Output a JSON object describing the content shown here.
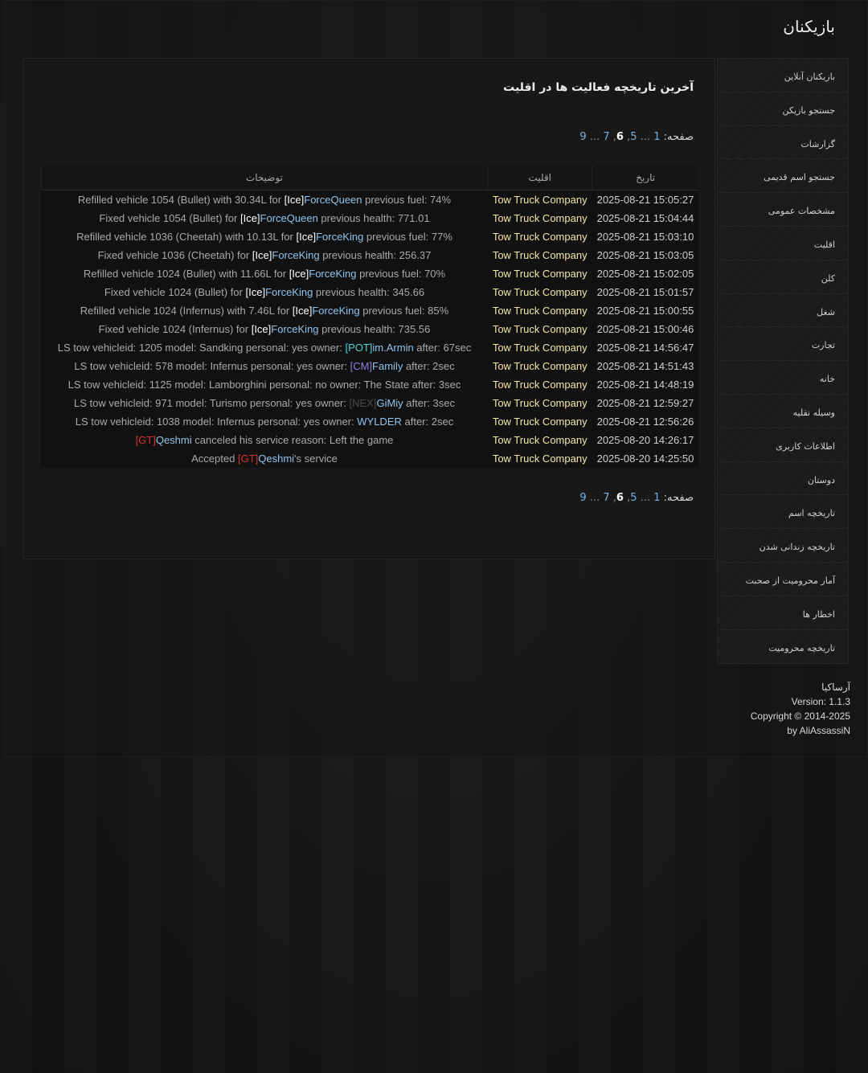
{
  "page_title": "بازیکنان",
  "sidebar": {
    "items": [
      {
        "label": "بازیکنان آنلاین"
      },
      {
        "label": "جستجو بازیکن"
      },
      {
        "label": "گزارشات"
      },
      {
        "label": "جستجو اسم قدیمی"
      },
      {
        "label": "مشخصات عمومی"
      },
      {
        "label": "اقلیت"
      },
      {
        "label": "کلن"
      },
      {
        "label": "شغل"
      },
      {
        "label": "تجارت"
      },
      {
        "label": "خانه"
      },
      {
        "label": "وسیله نقلیه"
      },
      {
        "label": "اطلاعات کاربری"
      },
      {
        "label": "دوستان"
      },
      {
        "label": "تاریخچه اسم"
      },
      {
        "label": "تاریخچه زندانی شدن"
      },
      {
        "label": "آمار محرومیت از صحبت"
      },
      {
        "label": "اخطار ها"
      },
      {
        "label": "تاریخچه محرومیت"
      }
    ]
  },
  "main": {
    "heading": "آخرین تاریخچه فعالیت ها در اقلیت",
    "pagination": {
      "label": "صفحه:",
      "first": "1",
      "ellipsis": "...",
      "p5": "5",
      "p6": "6",
      "p7": "7",
      "last": "9"
    },
    "table": {
      "headers": {
        "date": "تاریخ",
        "faction": "اقلیت",
        "description": "توضیحات"
      },
      "rows": [
        {
          "date": "2025-08-21 15:05:27",
          "faction": "Tow Truck Company",
          "pre": "Refilled vehicle 1054 (Bullet) with 30.34L for ",
          "tag": "[Ice]",
          "tag_color": "#ffffff",
          "name": "ForceQueen",
          "name_color": "#8fc4ee",
          "post": " previous fuel: 74%"
        },
        {
          "date": "2025-08-21 15:04:44",
          "faction": "Tow Truck Company",
          "pre": "Fixed vehicle 1054 (Bullet) for ",
          "tag": "[Ice]",
          "tag_color": "#ffffff",
          "name": "ForceQueen",
          "name_color": "#8fc4ee",
          "post": " previous health: 771.01"
        },
        {
          "date": "2025-08-21 15:03:10",
          "faction": "Tow Truck Company",
          "pre": "Refilled vehicle 1036 (Cheetah) with 10.13L for ",
          "tag": "[Ice]",
          "tag_color": "#ffffff",
          "name": "ForceKing",
          "name_color": "#8fc4ee",
          "post": " previous fuel: 77%"
        },
        {
          "date": "2025-08-21 15:03:05",
          "faction": "Tow Truck Company",
          "pre": "Fixed vehicle 1036 (Cheetah) for ",
          "tag": "[Ice]",
          "tag_color": "#ffffff",
          "name": "ForceKing",
          "name_color": "#8fc4ee",
          "post": " previous health: 256.37"
        },
        {
          "date": "2025-08-21 15:02:05",
          "faction": "Tow Truck Company",
          "pre": "Refilled vehicle 1024 (Bullet) with 11.66L for ",
          "tag": "[Ice]",
          "tag_color": "#ffffff",
          "name": "ForceKing",
          "name_color": "#8fc4ee",
          "post": " previous fuel: 70%"
        },
        {
          "date": "2025-08-21 15:01:57",
          "faction": "Tow Truck Company",
          "pre": "Fixed vehicle 1024 (Bullet) for ",
          "tag": "[Ice]",
          "tag_color": "#ffffff",
          "name": "ForceKing",
          "name_color": "#8fc4ee",
          "post": " previous health: 345.66"
        },
        {
          "date": "2025-08-21 15:00:55",
          "faction": "Tow Truck Company",
          "pre": "Refilled vehicle 1024 (Infernus) with 7.46L for ",
          "tag": "[Ice]",
          "tag_color": "#ffffff",
          "name": "ForceKing",
          "name_color": "#8fc4ee",
          "post": " previous fuel: 85%"
        },
        {
          "date": "2025-08-21 15:00:46",
          "faction": "Tow Truck Company",
          "pre": "Fixed vehicle 1024 (Infernus) for ",
          "tag": "[Ice]",
          "tag_color": "#ffffff",
          "name": "ForceKing",
          "name_color": "#8fc4ee",
          "post": " previous health: 735.56"
        },
        {
          "date": "2025-08-21 14:56:47",
          "faction": "Tow Truck Company",
          "pre": "LS tow vehicleid: 1205 model: Sandking personal: yes owner: ",
          "tag": "[POT]",
          "tag_color": "#4fd6d6",
          "name": "im.Armin",
          "name_color": "#8fc4ee",
          "post": " after: 67sec"
        },
        {
          "date": "2025-08-21 14:51:43",
          "faction": "Tow Truck Company",
          "pre": "LS tow vehicleid: 578 model: Infernus personal: yes owner: ",
          "tag": "[CM]",
          "tag_color": "#8f7fe0",
          "name": "Family",
          "name_color": "#8fc4ee",
          "post": " after: 2sec"
        },
        {
          "date": "2025-08-21 14:48:19",
          "faction": "Tow Truck Company",
          "pre": "LS tow vehicleid: 1125 model: Lamborghini personal: no owner: The State after: 3sec",
          "tag": "",
          "tag_color": "#ffffff",
          "name": "",
          "name_color": "#8fc4ee",
          "post": ""
        },
        {
          "date": "2025-08-21 12:59:27",
          "faction": "Tow Truck Company",
          "pre": "LS tow vehicleid: 971 model: Turismo personal: yes owner: ",
          "tag": "[NEX]",
          "tag_color": "#4a4a4a",
          "name": "GiMiy",
          "name_color": "#8fc4ee",
          "post": " after: 3sec"
        },
        {
          "date": "2025-08-21 12:56:26",
          "faction": "Tow Truck Company",
          "pre": "LS tow vehicleid: 1038 model: Infernus personal: yes owner: ",
          "tag": "",
          "tag_color": "#ffffff",
          "name": "WYLDER",
          "name_color": "#8fc4ee",
          "post": " after: 2sec"
        },
        {
          "date": "2025-08-20 14:26:17",
          "faction": "Tow Truck Company",
          "pre": "",
          "tag": "[GT]",
          "tag_color": "#d9322f",
          "name": "Qeshmi",
          "name_color": "#8fc4ee",
          "post": " canceled his service reason: Left the game"
        },
        {
          "date": "2025-08-20 14:25:50",
          "faction": "Tow Truck Company",
          "pre": "Accepted ",
          "tag": "[GT]",
          "tag_color": "#d9322f",
          "name": "Qeshmi",
          "name_color": "#8fc4ee",
          "post": "'s service"
        }
      ]
    }
  },
  "footer": {
    "site": "آرساکیا",
    "version": "Version: 1.1.3",
    "copyright": "Copyright © 2014-2025",
    "author": "by AliAssassiN"
  }
}
